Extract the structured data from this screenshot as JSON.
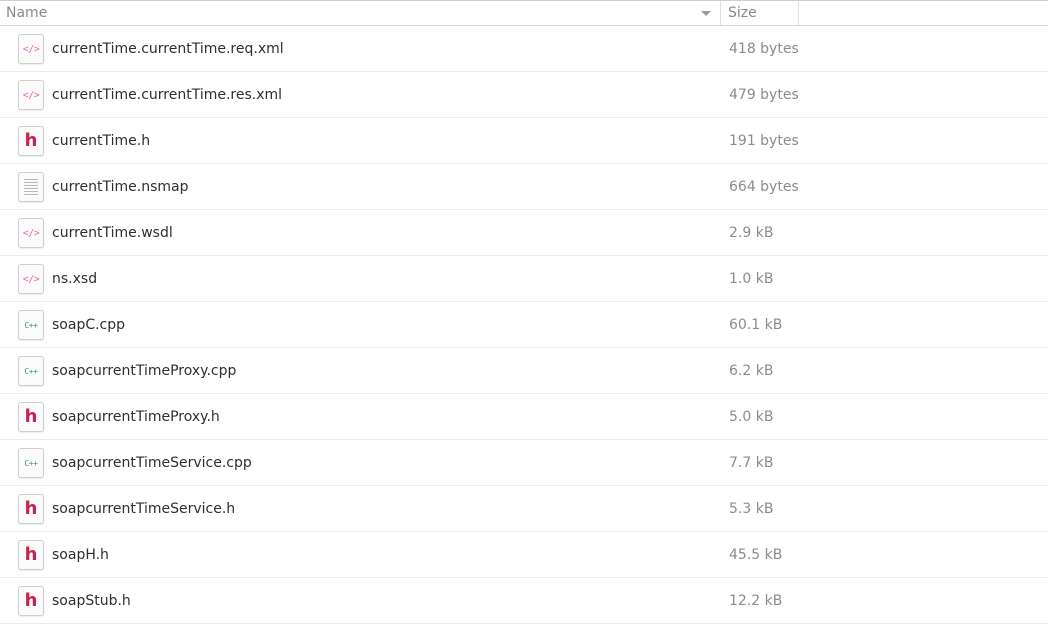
{
  "columns": {
    "name": "Name",
    "size": "Size"
  },
  "files": [
    {
      "name": "currentTime.currentTime.req.xml",
      "size": "418 bytes",
      "icon": "xml-file-icon",
      "glyph": "</>"
    },
    {
      "name": "currentTime.currentTime.res.xml",
      "size": "479 bytes",
      "icon": "xml-file-icon",
      "glyph": "</>"
    },
    {
      "name": "currentTime.h",
      "size": "191 bytes",
      "icon": "header-file-icon",
      "glyph": "h"
    },
    {
      "name": "currentTime.nsmap",
      "size": "664 bytes",
      "icon": "text-file-icon",
      "glyph": ""
    },
    {
      "name": "currentTime.wsdl",
      "size": "2.9 kB",
      "icon": "xml-file-icon",
      "glyph": "</>"
    },
    {
      "name": "ns.xsd",
      "size": "1.0 kB",
      "icon": "xml-file-icon",
      "glyph": "</>"
    },
    {
      "name": "soapC.cpp",
      "size": "60.1 kB",
      "icon": "cpp-file-icon",
      "glyph": "C++"
    },
    {
      "name": "soapcurrentTimeProxy.cpp",
      "size": "6.2 kB",
      "icon": "cpp-file-icon",
      "glyph": "C++"
    },
    {
      "name": "soapcurrentTimeProxy.h",
      "size": "5.0 kB",
      "icon": "header-file-icon",
      "glyph": "h"
    },
    {
      "name": "soapcurrentTimeService.cpp",
      "size": "7.7 kB",
      "icon": "cpp-file-icon",
      "glyph": "C++"
    },
    {
      "name": "soapcurrentTimeService.h",
      "size": "5.3 kB",
      "icon": "header-file-icon",
      "glyph": "h"
    },
    {
      "name": "soapH.h",
      "size": "45.5 kB",
      "icon": "header-file-icon",
      "glyph": "h"
    },
    {
      "name": "soapStub.h",
      "size": "12.2 kB",
      "icon": "header-file-icon",
      "glyph": "h"
    }
  ],
  "colors": {
    "xml_glyph": "#e06ab8",
    "header_glyph": "#c8224e",
    "cpp_glyph": "#3f8e8a"
  }
}
